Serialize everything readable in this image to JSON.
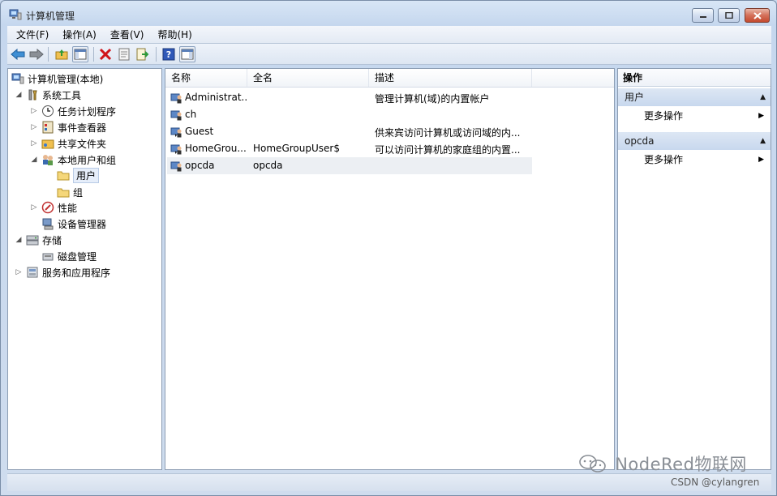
{
  "window": {
    "title": "计算机管理",
    "controls": [
      "minimize",
      "maximize",
      "close"
    ]
  },
  "menubar": {
    "items": [
      "文件(F)",
      "操作(A)",
      "查看(V)",
      "帮助(H)"
    ]
  },
  "toolbar": {
    "buttons": [
      "back-icon",
      "forward-icon",
      "up-folder-icon",
      "show-hide-tree-icon",
      "delete-icon",
      "properties-icon",
      "export-icon",
      "help-icon",
      "show-hide-action-pane-icon"
    ]
  },
  "tree": {
    "root": "计算机管理(本地)",
    "system_tools": "系统工具",
    "task_scheduler": "任务计划程序",
    "event_viewer": "事件查看器",
    "shared_folders": "共享文件夹",
    "local_users_groups": "本地用户和组",
    "users": "用户",
    "groups": "组",
    "performance": "性能",
    "device_manager": "设备管理器",
    "storage": "存储",
    "disk_management": "磁盘管理",
    "services_apps": "服务和应用程序"
  },
  "list": {
    "columns": [
      "名称",
      "全名",
      "描述"
    ],
    "rows": [
      {
        "name": "Administrat...",
        "fullname": "",
        "desc": "管理计算机(域)的内置帐户"
      },
      {
        "name": "ch",
        "fullname": "",
        "desc": ""
      },
      {
        "name": "Guest",
        "fullname": "",
        "desc": "供来宾访问计算机或访问域的内..."
      },
      {
        "name": "HomeGrou...",
        "fullname": "HomeGroupUser$",
        "desc": "可以访问计算机的家庭组的内置..."
      },
      {
        "name": "opcda",
        "fullname": "opcda",
        "desc": ""
      }
    ]
  },
  "actions": {
    "header": "操作",
    "sections": [
      {
        "title": "用户",
        "item": "更多操作"
      },
      {
        "title": "opcda",
        "item": "更多操作"
      }
    ]
  },
  "watermark": "NodeRed物联网",
  "credit": "CSDN @cylangren",
  "colors": {
    "accent": "#c8d8ee",
    "selection": "#e6eefa",
    "border": "#8c9db3"
  }
}
